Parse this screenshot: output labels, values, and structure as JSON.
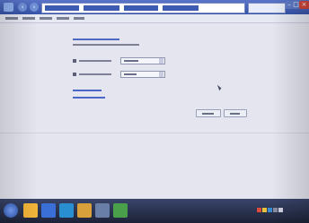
{
  "window": {
    "nav_back_glyph": "‹",
    "nav_forward_glyph": "›",
    "minimize_glyph": "–",
    "maximize_glyph": "□",
    "close_glyph": "×"
  },
  "taskbar": {
    "clock_time": "",
    "clock_date": "",
    "app_colors": [
      "#f0b43a",
      "#3a6fd8",
      "#2a8fd0",
      "#d8a03a",
      "#6a7fa8",
      "#4aa04a"
    ],
    "tray_colors": [
      "#e04a3a",
      "#e8c23a",
      "#3a8ad0",
      "#8a8aa0",
      "#d0d0e0"
    ]
  },
  "colors": {
    "titlebar": "#3553a8",
    "link": "#4a66c6",
    "close": "#d0443a"
  }
}
